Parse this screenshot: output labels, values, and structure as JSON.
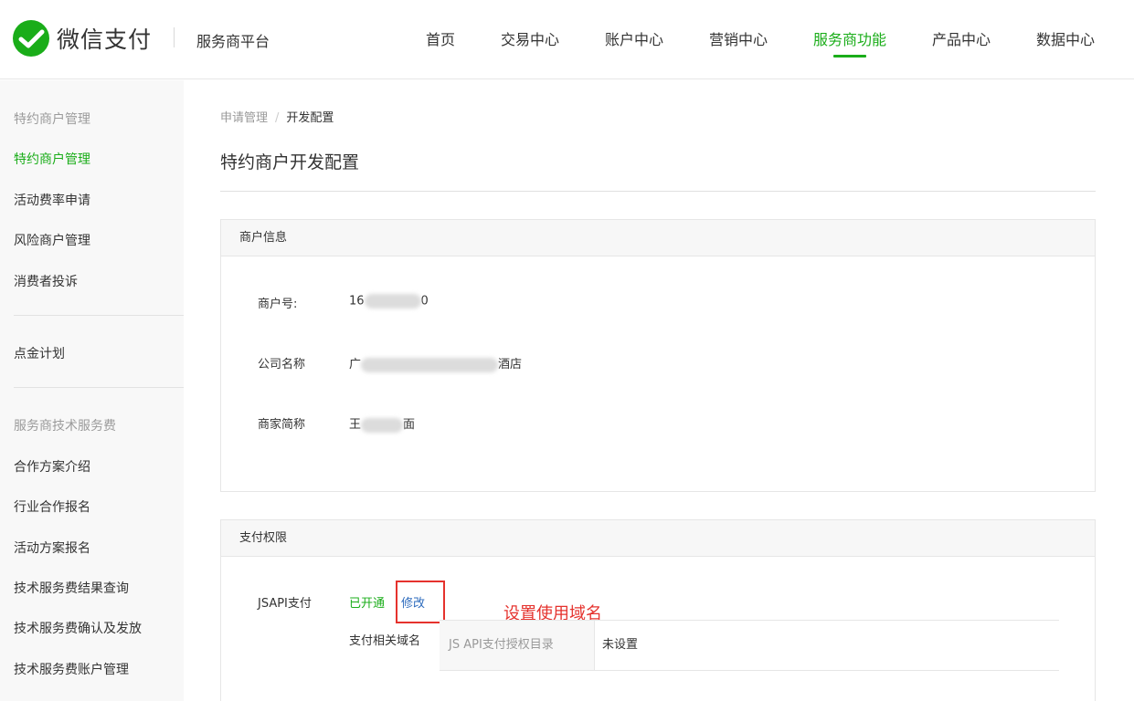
{
  "header": {
    "logo_text": "微信支付",
    "platform": "服务商平台",
    "nav": [
      {
        "label": "首页",
        "active": false
      },
      {
        "label": "交易中心",
        "active": false
      },
      {
        "label": "账户中心",
        "active": false
      },
      {
        "label": "营销中心",
        "active": false
      },
      {
        "label": "服务商功能",
        "active": true
      },
      {
        "label": "产品中心",
        "active": false
      },
      {
        "label": "数据中心",
        "active": false
      }
    ]
  },
  "sidebar": {
    "group1": "特约商户管理",
    "items1": [
      "特约商户管理",
      "活动费率申请",
      "风险商户管理",
      "消费者投诉"
    ],
    "standalone": "点金计划",
    "group2": "服务商技术服务费",
    "items2": [
      "合作方案介绍",
      "行业合作报名",
      "活动方案报名",
      "技术服务费结果查询",
      "技术服务费确认及发放",
      "技术服务费账户管理"
    ]
  },
  "breadcrumb": {
    "parent": "申请管理",
    "separator": "/",
    "current": "开发配置"
  },
  "page_title": "特约商户开发配置",
  "merchant_info": {
    "title": "商户信息",
    "merchant_id_label": "商户号:",
    "merchant_id_prefix": "16",
    "merchant_id_suffix": "0",
    "company_label": "公司名称",
    "company_prefix": "广",
    "company_suffix": "酒店",
    "short_name_label": "商家简称",
    "short_name_prefix": "王",
    "short_name_suffix": "面"
  },
  "payment": {
    "title": "支付权限",
    "jsapi_label": "JSAPI支付",
    "status": "已开通",
    "edit": "修改",
    "annotation": "设置使用域名",
    "domain_label": "支付相关域名",
    "dir_key": "JS API支付授权目录",
    "dir_value": "未设置"
  },
  "colors": {
    "brand": "#1aad19",
    "link": "#2d6bbd",
    "annotation": "#e5322d"
  }
}
